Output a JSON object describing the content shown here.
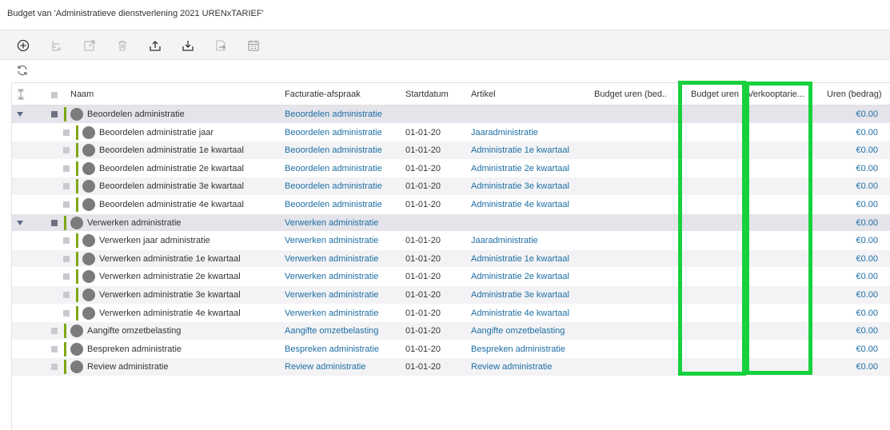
{
  "window": {
    "title": "Budget van 'Administratieve dienstverlening 2021 URENxTARIEF'"
  },
  "toolbar": {
    "buttons": [
      {
        "name": "add-button",
        "icon": "plus-circle-icon"
      },
      {
        "name": "insert-row-button",
        "icon": "insert-row-icon"
      },
      {
        "name": "edit-button",
        "icon": "edit-external-icon"
      },
      {
        "name": "delete-button",
        "icon": "trash-icon"
      },
      {
        "name": "export-button",
        "icon": "upload-tray-icon"
      },
      {
        "name": "import-button",
        "icon": "download-tray-icon"
      },
      {
        "name": "transfer-button",
        "icon": "document-arrow-icon"
      },
      {
        "name": "calendar-button",
        "icon": "calendar-grid-icon"
      }
    ],
    "refresh_icon": "refresh-icon"
  },
  "columns": {
    "naam": "Naam",
    "facturatie": "Facturatie-afspraak",
    "startdatum": "Startdatum",
    "artikel": "Artikel",
    "budget_uren_bedrag": "Budget uren (bed...",
    "budget_uren": "Budget uren",
    "verkooptarief": "Verkooptarie...",
    "uren_bedrag": "Uren (bedrag)"
  },
  "rows": [
    {
      "type": "group",
      "naam": "Beoordelen administratie",
      "facturatie": "Beoordelen administratie",
      "startdatum": "",
      "artikel": "",
      "uren_bedrag": "€0.00"
    },
    {
      "type": "child",
      "naam": "Beoordelen administratie jaar",
      "facturatie": "Beoordelen administratie",
      "startdatum": "01-01-20",
      "artikel": "Jaaradministratie",
      "uren_bedrag": "€0.00"
    },
    {
      "type": "child",
      "naam": "Beoordelen administratie 1e kwartaal",
      "facturatie": "Beoordelen administratie",
      "startdatum": "01-01-20",
      "artikel": "Administratie 1e kwartaal",
      "uren_bedrag": "€0.00"
    },
    {
      "type": "child",
      "naam": "Beoordelen administratie 2e kwartaal",
      "facturatie": "Beoordelen administratie",
      "startdatum": "01-01-20",
      "artikel": "Administratie 2e kwartaal",
      "uren_bedrag": "€0.00"
    },
    {
      "type": "child",
      "naam": "Beoordelen administratie 3e kwartaal",
      "facturatie": "Beoordelen administratie",
      "startdatum": "01-01-20",
      "artikel": "Administratie 3e kwartaal",
      "uren_bedrag": "€0.00"
    },
    {
      "type": "child",
      "naam": "Beoordelen administratie 4e kwartaal",
      "facturatie": "Beoordelen administratie",
      "startdatum": "01-01-20",
      "artikel": "Administratie 4e kwartaal",
      "uren_bedrag": "€0.00"
    },
    {
      "type": "group",
      "naam": "Verwerken administratie",
      "facturatie": "Verwerken administratie",
      "startdatum": "",
      "artikel": "",
      "uren_bedrag": "€0.00"
    },
    {
      "type": "child",
      "naam": "Verwerken jaar administratie",
      "facturatie": "Verwerken administratie",
      "startdatum": "01-01-20",
      "artikel": "Jaaradministratie",
      "uren_bedrag": "€0.00"
    },
    {
      "type": "child",
      "naam": "Verwerken administratie 1e kwartaal",
      "facturatie": "Verwerken administratie",
      "startdatum": "01-01-20",
      "artikel": "Administratie 1e kwartaal",
      "uren_bedrag": "€0.00"
    },
    {
      "type": "child",
      "naam": "Verwerken administratie 2e kwartaal",
      "facturatie": "Verwerken administratie",
      "startdatum": "01-01-20",
      "artikel": "Administratie 2e kwartaal",
      "uren_bedrag": "€0.00"
    },
    {
      "type": "child",
      "naam": "Verwerken administratie 3e kwartaal",
      "facturatie": "Verwerken administratie",
      "startdatum": "01-01-20",
      "artikel": "Administratie 3e kwartaal",
      "uren_bedrag": "€0.00"
    },
    {
      "type": "child",
      "naam": "Verwerken administratie 4e kwartaal",
      "facturatie": "Verwerken administratie",
      "startdatum": "01-01-20",
      "artikel": "Administratie 4e kwartaal",
      "uren_bedrag": "€0.00"
    },
    {
      "type": "single",
      "naam": "Aangifte omzetbelasting",
      "facturatie": "Aangifte omzetbelasting",
      "startdatum": "01-01-20",
      "artikel": "Aangifte omzetbelasting",
      "uren_bedrag": "€0.00"
    },
    {
      "type": "single",
      "naam": "Bespreken administratie",
      "facturatie": "Bespreken administratie",
      "startdatum": "01-01-20",
      "artikel": "Bespreken administratie",
      "uren_bedrag": "€0.00"
    },
    {
      "type": "single",
      "naam": "Review administratie",
      "facturatie": "Review administratie",
      "startdatum": "01-01-20",
      "artikel": "Review administratie",
      "uren_bedrag": "€0.00"
    }
  ],
  "colors": {
    "accent_green": "#7ea817",
    "link_blue": "#1d6ea3",
    "highlight_box": "#17d13d"
  }
}
